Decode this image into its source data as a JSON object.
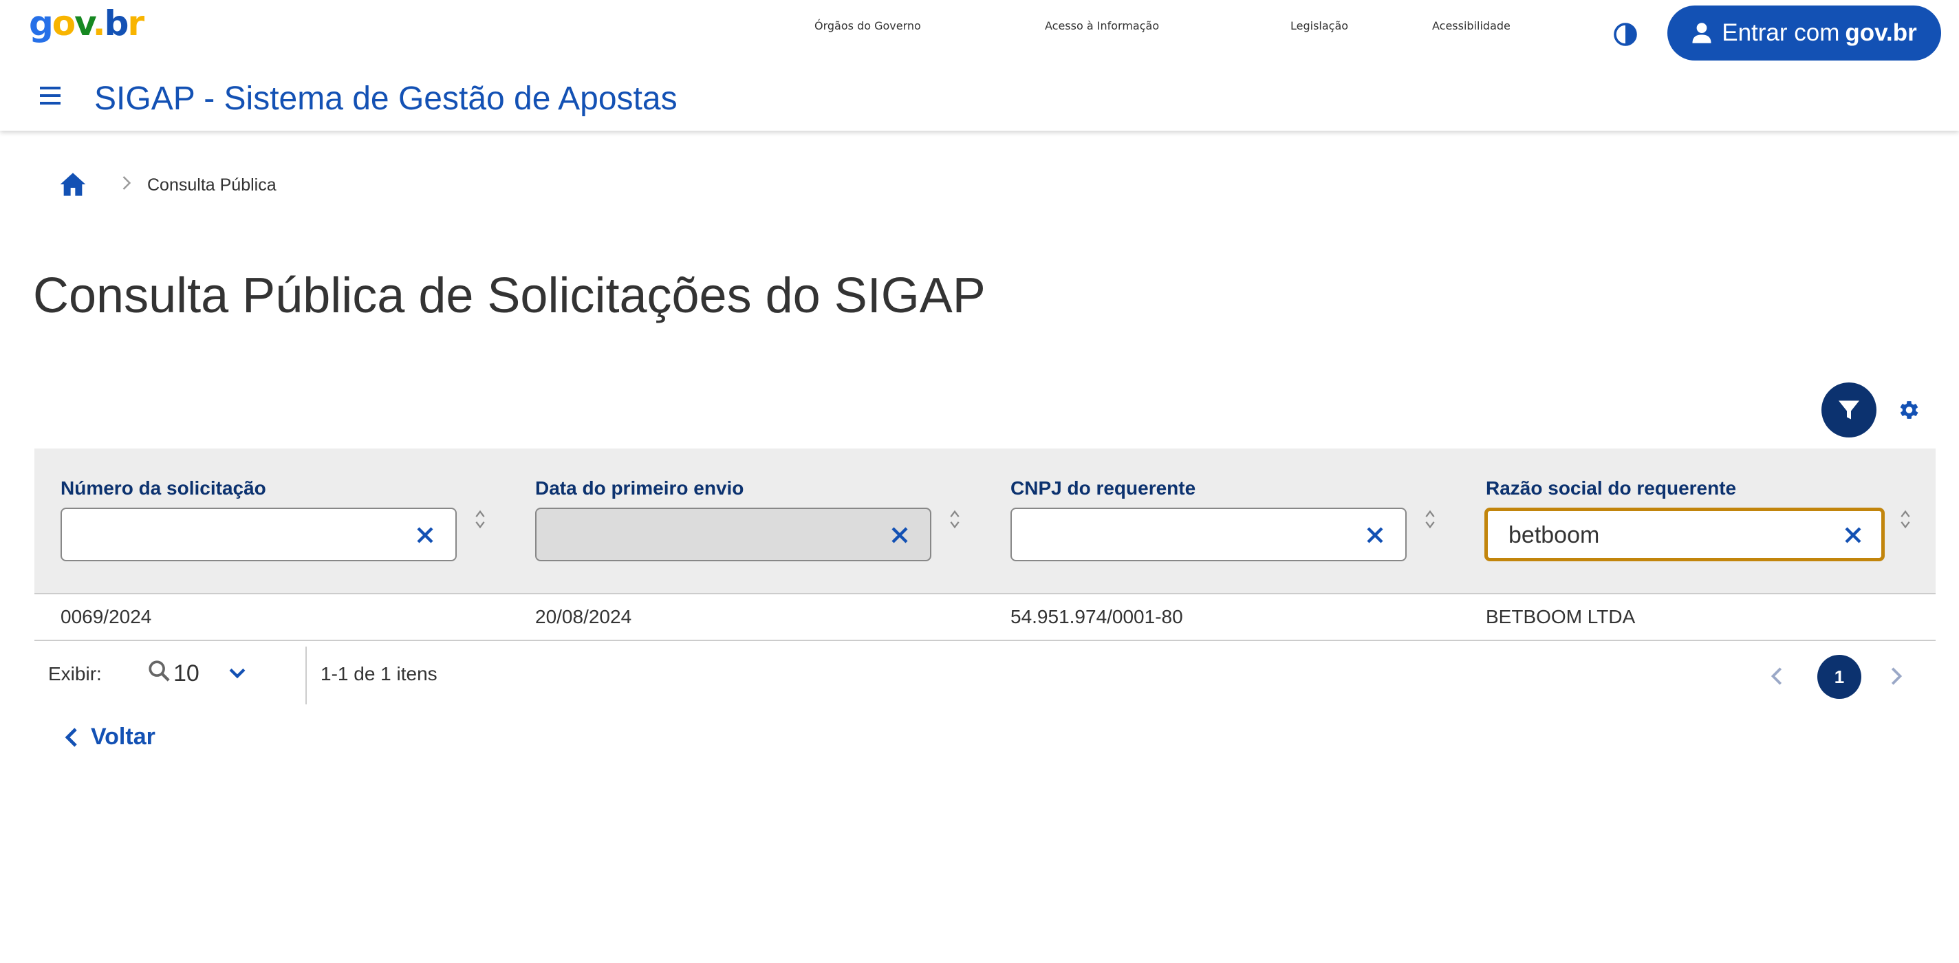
{
  "header": {
    "logo": {
      "g": "g",
      "o": "o",
      "v": "v",
      "dot": ".",
      "b": "b",
      "r": "r"
    },
    "nav": [
      "Órgãos do Governo",
      "Acesso à Informação",
      "Legislação",
      "Acessibilidade"
    ],
    "login_label": "Entrar com",
    "login_brand": "gov.br",
    "app_title": "SIGAP - Sistema de Gestão de Apostas"
  },
  "breadcrumb": {
    "current": "Consulta Pública"
  },
  "page_title": "Consulta Pública de Solicitações do SIGAP",
  "filters": [
    {
      "label": "Número da solicitação",
      "value": "",
      "disabled": false
    },
    {
      "label": "Data do primeiro envio",
      "value": "",
      "disabled": true
    },
    {
      "label": "CNPJ do requerente",
      "value": "",
      "disabled": false
    },
    {
      "label": "Razão social do requerente",
      "value": "betboom",
      "focused": true
    }
  ],
  "rows": [
    {
      "numero": "0069/2024",
      "data": "20/08/2024",
      "cnpj": "54.951.974/0001-80",
      "razao": "BETBOOM LTDA"
    }
  ],
  "pagination": {
    "exibir_label": "Exibir:",
    "page_size": "10",
    "range_text": "1-1 de 1 itens",
    "current_page": "1"
  },
  "back_label": "Voltar",
  "colors": {
    "primary": "#1351b4",
    "dark_blue": "#0c326f",
    "focus": "#c2850c"
  }
}
